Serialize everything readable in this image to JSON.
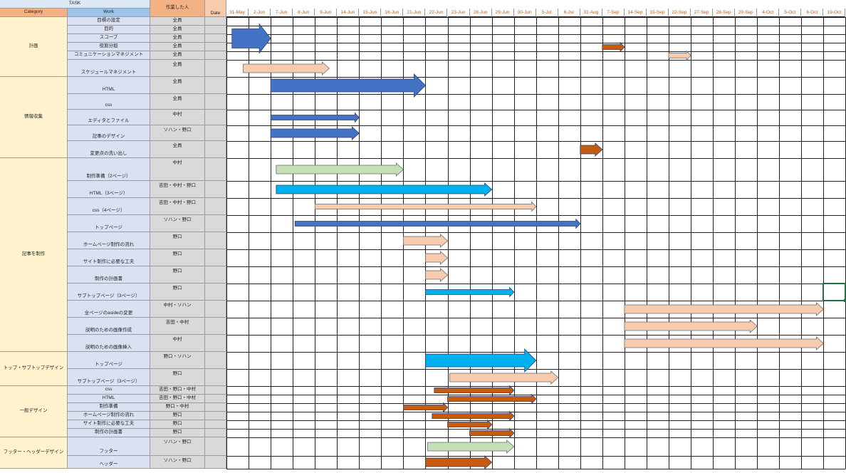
{
  "header": {
    "task_label": "TASK",
    "category_label": "Category",
    "work_label": "Work",
    "assignee_label": "作業した人",
    "date_label": "Date"
  },
  "dates": [
    "31-May",
    "2-Jun",
    "7-Jun",
    "8-Jun",
    "9-Jun",
    "14-Jun",
    "15-Jun",
    "16-Jun",
    "21-Jun",
    "22-Jun",
    "23-Jun",
    "28-Jun",
    "29-Jun",
    "30-Jun",
    "5-Jul",
    "6-Jul",
    "31-Aug",
    "7-Sep",
    "14-Sep",
    "15-Sep",
    "22-Sep",
    "27-Sep",
    "28-Sep",
    "29-Sep",
    "4-Oct",
    "5-Oct",
    "6-Oct",
    "19-Oct"
  ],
  "categories": [
    {
      "label": "計画"
    },
    {
      "label": "情報収集"
    },
    {
      "label": "記事を制作"
    },
    {
      "label": "トップ・サブトップデザイン"
    },
    {
      "label": "一般デザイン"
    },
    {
      "label": "フッター・ヘッダーデザイン"
    }
  ],
  "tasks": [
    {
      "work": "目標の設定",
      "who": "全員"
    },
    {
      "work": "目的",
      "who": "全員"
    },
    {
      "work": "スコープ",
      "who": "全員"
    },
    {
      "work": "役割分担",
      "who": "全員"
    },
    {
      "work": "コミュニケーションマネジメント",
      "who": "全員"
    },
    {
      "work": "スケジュールマネジメント",
      "who": "全員"
    },
    {
      "work": "HTML",
      "who": "全員"
    },
    {
      "work": "css",
      "who": "全員"
    },
    {
      "work": "エディタとファイル",
      "who": "中村"
    },
    {
      "work": "記事のデザイン",
      "who": "ソハン・野口"
    },
    {
      "work": "変更点の洗い出し",
      "who": "全員"
    },
    {
      "work": "制作準備（2ページ）",
      "who": "中村"
    },
    {
      "work": "HTML（3ページ）",
      "who": "吉田・中村・野口"
    },
    {
      "work": "css（4ページ）",
      "who": "吉田・中村・野口"
    },
    {
      "work": "トップページ",
      "who": "ソハン・野口"
    },
    {
      "work": "ホームページ制作の流れ",
      "who": "野口"
    },
    {
      "work": "サイト制作に必要な工夫",
      "who": "野口"
    },
    {
      "work": "制作の計画書",
      "who": "野口"
    },
    {
      "work": "サブトップページ（3ページ）",
      "who": "野口"
    },
    {
      "work": "全ページのasideの変更",
      "who": "中村・ソハン"
    },
    {
      "work": "説明のための画像作成",
      "who": "吉田・中村"
    },
    {
      "work": "説明のための画像挿入",
      "who": "中村"
    },
    {
      "work": "トップページ",
      "who": "野口・ソハン"
    },
    {
      "work": "サブトップページ（3ページ）",
      "who": "野口"
    },
    {
      "work": "css",
      "who": "吉田・野口・中村"
    },
    {
      "work": "HTML",
      "who": "吉田・野口・中村"
    },
    {
      "work": "制作準備",
      "who": "野口・中村"
    },
    {
      "work": "ホームページ制作の流れ",
      "who": "野口"
    },
    {
      "work": "サイト制作に必要な工夫",
      "who": "野口"
    },
    {
      "work": "制作の計画書",
      "who": "野口"
    },
    {
      "work": "フッター",
      "who": "ソハン・野口"
    },
    {
      "work": "ヘッダー",
      "who": "ソハン・野口"
    }
  ],
  "bars": [
    {
      "task": 2,
      "start": 0.25,
      "end": 2.0,
      "color": "#4472c4",
      "thickness": "large"
    },
    {
      "task": 3,
      "start": 17.0,
      "end": 18.0,
      "color": "#c55a11",
      "thickness": "small"
    },
    {
      "task": 4,
      "start": 20.0,
      "end": 21.0,
      "color": "#f8cbad",
      "thickness": "small"
    },
    {
      "task": 5,
      "start": 0.75,
      "end": 4.65,
      "color": "#f8cbad",
      "thickness": "medium"
    },
    {
      "task": 6,
      "start": 2.0,
      "end": 9.0,
      "color": "#4472c4",
      "thickness": "large"
    },
    {
      "task": 8,
      "start": 2.0,
      "end": 6.0,
      "color": "#4472c4",
      "thickness": "small"
    },
    {
      "task": 9,
      "start": 2.0,
      "end": 6.0,
      "color": "#4472c4",
      "thickness": "medium"
    },
    {
      "task": 10,
      "start": 16.0,
      "end": 17.0,
      "color": "#c55a11",
      "thickness": "medium"
    },
    {
      "task": 11,
      "start": 2.25,
      "end": 8.0,
      "color": "#c5e0b4",
      "thickness": "medium"
    },
    {
      "task": 12,
      "start": 2.25,
      "end": 12.0,
      "color": "#00b0f0",
      "thickness": "medium"
    },
    {
      "task": 13,
      "start": 4.0,
      "end": 14.0,
      "color": "#f8cbad",
      "thickness": "small"
    },
    {
      "task": 14,
      "start": 3.1,
      "end": 16.0,
      "color": "#4472c4",
      "thickness": "small"
    },
    {
      "task": 15,
      "start": 8.0,
      "end": 10.0,
      "color": "#f8cbad",
      "thickness": "medium"
    },
    {
      "task": 16,
      "start": 9.0,
      "end": 10.0,
      "color": "#f8cbad",
      "thickness": "medium"
    },
    {
      "task": 17,
      "start": 9.0,
      "end": 10.0,
      "color": "#f8cbad",
      "thickness": "medium"
    },
    {
      "task": 18,
      "start": 9.0,
      "end": 13.0,
      "color": "#00b0f0",
      "thickness": "small"
    },
    {
      "task": 19,
      "start": 18.0,
      "end": 27.0,
      "color": "#f8cbad",
      "thickness": "medium"
    },
    {
      "task": 20,
      "start": 18.0,
      "end": 24.0,
      "color": "#f8cbad",
      "thickness": "medium"
    },
    {
      "task": 21,
      "start": 18.0,
      "end": 27.0,
      "color": "#f8cbad",
      "thickness": "medium"
    },
    {
      "task": 22,
      "start": 9.0,
      "end": 14.0,
      "color": "#00b0f0",
      "thickness": "large"
    },
    {
      "task": 23,
      "start": 10.1,
      "end": 15.0,
      "color": "#f8cbad",
      "thickness": "medium"
    },
    {
      "task": 24,
      "start": 9.4,
      "end": 13.0,
      "color": "#c55a11",
      "thickness": "small"
    },
    {
      "task": 25,
      "start": 10.0,
      "end": 14.0,
      "color": "#c55a11",
      "thickness": "small"
    },
    {
      "task": 26,
      "start": 8.0,
      "end": 10.0,
      "color": "#c55a11",
      "thickness": "small"
    },
    {
      "task": 27,
      "start": 9.3,
      "end": 13.0,
      "color": "#c55a11",
      "thickness": "small"
    },
    {
      "task": 28,
      "start": 10.0,
      "end": 12.0,
      "color": "#c55a11",
      "thickness": "small"
    },
    {
      "task": 29,
      "start": 11.0,
      "end": 13.0,
      "color": "#c55a11",
      "thickness": "small"
    },
    {
      "task": 30,
      "start": 9.1,
      "end": 13.0,
      "color": "#c5e0b4",
      "thickness": "medium"
    },
    {
      "task": 31,
      "start": 9.0,
      "end": 12.0,
      "color": "#c55a11",
      "thickness": "medium"
    }
  ],
  "selected_cell": {
    "task": 18,
    "column": 27
  }
}
